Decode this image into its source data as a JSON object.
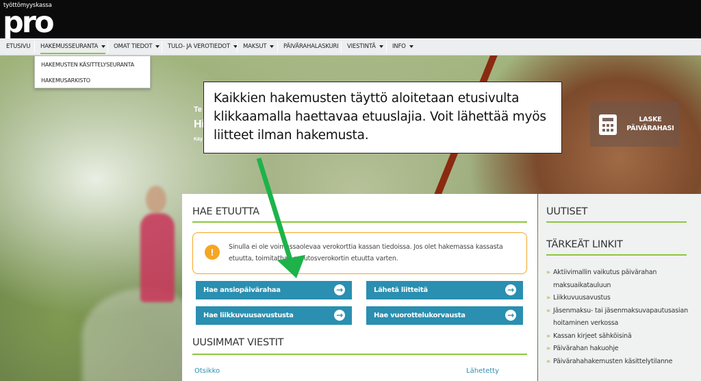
{
  "brand": {
    "small": "työttömyyskassa",
    "big": "pro"
  },
  "nav": {
    "items": [
      {
        "label": "ETUSIVU",
        "has_caret": false
      },
      {
        "label": "HAKEMUSSEURANTA",
        "has_caret": true,
        "active": true
      },
      {
        "label": "OMAT TIEDOT",
        "has_caret": true
      },
      {
        "label": "TULO- JA VEROTIEDOT",
        "has_caret": true
      },
      {
        "label": "MAKSUT",
        "has_caret": true
      },
      {
        "label": "PÄIVÄRAHALASKURI",
        "has_caret": false
      },
      {
        "label": "VIESTINTÄ",
        "has_caret": true
      },
      {
        "label": "INFO",
        "has_caret": true
      }
    ],
    "dropdown": [
      "HAKEMUSTEN KÄSITTELYSEURANTA",
      "HAKEMUSARKISTO"
    ]
  },
  "hero": {
    "text_line1": "Te",
    "text_line2": "Hi",
    "text_line3": "Käy",
    "calc_label": "LASKE PÄIVÄRAHASI"
  },
  "callout": {
    "text": "Kaikkien hakemusten täyttö aloitetaan etusivulta klikkaamalla haettavaa etuuslajia. Voit lähettää myös liitteet ilman hakemusta."
  },
  "main": {
    "apply_title": "HAE ETUUTTA",
    "notice_text": "Sinulla ei ole voimassaolevaa verokorttia kassan tiedoissa. Jos olet hakemassa kassasta etuutta, toimitathan muutosverokortin etuutta varten.",
    "buttons": {
      "ansiopaivaraha": "Hae ansiopäivärahaa",
      "liitteet": "Lähetä liitteitä",
      "liikkuvuus": "Hae liikkuvuusavustusta",
      "vuorottelu": "Hae vuorottelukorvausta"
    },
    "messages_title": "UUSIMMAT VIESTIT",
    "col_subject": "Otsikko",
    "col_sent": "Lähetetty"
  },
  "sidebar": {
    "news_title": "UUTISET",
    "links_title": "TÄRKEÄT LINKIT",
    "links": [
      "Aktiivimallin vaikutus päivärahan maksuaikatauluun",
      "Liikkuvuusavustus",
      "Jäsenmaksu- tai jäsenmaksuvapautusasian hoitaminen verkossa",
      "Kassan kirjeet sähköisinä",
      "Päivärahan hakuohje",
      "Päivärahahakemusten käsittelytilanne"
    ]
  },
  "colors": {
    "accent_green": "#8dc63f",
    "button_blue": "#2a8fb0",
    "warning_orange": "#f5a623",
    "arrow_green": "#1db34a"
  }
}
